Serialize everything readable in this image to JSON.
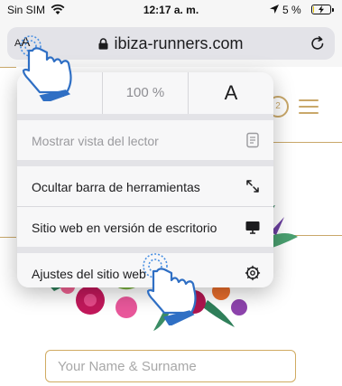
{
  "status_bar": {
    "carrier": "Sin SIM",
    "time": "12:17 a. m.",
    "battery_percent": "5 %",
    "battery_level": 0.05,
    "icons": [
      "wifi-icon",
      "location-arrow-icon",
      "battery-charging-icon"
    ]
  },
  "address_bar": {
    "aa_small": "A",
    "aa_large": "A",
    "url": "ibiza-runners.com",
    "icons": [
      "lock-icon",
      "reload-icon"
    ]
  },
  "popup": {
    "zoom": {
      "decrease": "A",
      "level": "100 %",
      "increase": "A"
    },
    "items": [
      {
        "label": "Mostrar vista del lector",
        "icon": "reader-view-icon",
        "enabled": false
      },
      {
        "label": "Ocultar barra de herramientas",
        "icon": "collapse-arrows-icon",
        "enabled": true
      },
      {
        "label": "Sitio web en versión de escritorio",
        "icon": "desktop-icon",
        "enabled": true
      },
      {
        "label": "Ajustes del sitio web",
        "icon": "gear-icon",
        "enabled": true
      }
    ]
  },
  "page": {
    "form": {
      "name_placeholder": "Your Name & Surname"
    },
    "accent_color": "#c9a86a",
    "icons": [
      "account-circle-icon",
      "hamburger-menu-icon",
      "tropical-flowers-illustration"
    ]
  },
  "overlays": [
    "tap-hand-icon",
    "tap-hand-icon"
  ]
}
